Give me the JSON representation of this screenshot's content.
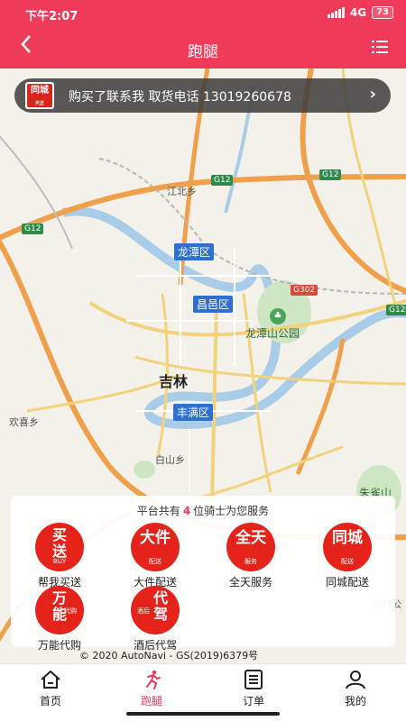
{
  "status": {
    "time": "下午2:07",
    "network": "4G",
    "battery": "73"
  },
  "nav": {
    "back_icon": "chevron-left-icon",
    "title": "跑腿",
    "menu_icon": "list-icon"
  },
  "notice": {
    "logo_text": "同城",
    "logo_sub": "天正",
    "text": "购买了联系我  取货电话 13019260678",
    "arrow": "›"
  },
  "map": {
    "city": "吉林",
    "districts": [
      "龙潭区",
      "昌邑区",
      "丰满区"
    ],
    "roads": [
      "G12",
      "G12",
      "G12",
      "G302",
      "G12"
    ],
    "places": [
      "江北乡",
      "欢喜乡",
      "白山乡",
      "龙潭山公园",
      "朱雀山",
      "吉林公"
    ],
    "colors": {
      "land": "#f4f1ea",
      "water": "#a9cde8",
      "highway": "#f0a04b",
      "road": "#f2d27a",
      "district": "#2f6fd0"
    }
  },
  "panel": {
    "prefix": "平台共有",
    "count": "4",
    "suffix": "位骑士为您服务",
    "services": [
      {
        "icon": "buy-deliver-icon",
        "big": "买送",
        "small": "BUY",
        "label": "帮我买送"
      },
      {
        "icon": "large-item-icon",
        "big": "大件",
        "small": "配送",
        "label": "大件配送"
      },
      {
        "icon": "all-day-icon",
        "big": "全天",
        "small": "服务",
        "label": "全天服务"
      },
      {
        "icon": "same-city-icon",
        "big": "同城",
        "small": "配送",
        "label": "同城配送"
      },
      {
        "icon": "universal-buy-icon",
        "big": "万能",
        "small": "代购",
        "label": "万能代购"
      },
      {
        "icon": "designated-driver-icon",
        "big": "代驾",
        "small": "酒后",
        "label": "酒后代驾"
      }
    ]
  },
  "copyright": "© 2020 AutoNavi - GS(2019)6379号",
  "tabs": [
    {
      "icon": "home-icon",
      "label": "首页"
    },
    {
      "icon": "runner-icon",
      "label": "跑腿"
    },
    {
      "icon": "order-icon",
      "label": "订单"
    },
    {
      "icon": "profile-icon",
      "label": "我的"
    }
  ],
  "accent": "#ef3a5a"
}
